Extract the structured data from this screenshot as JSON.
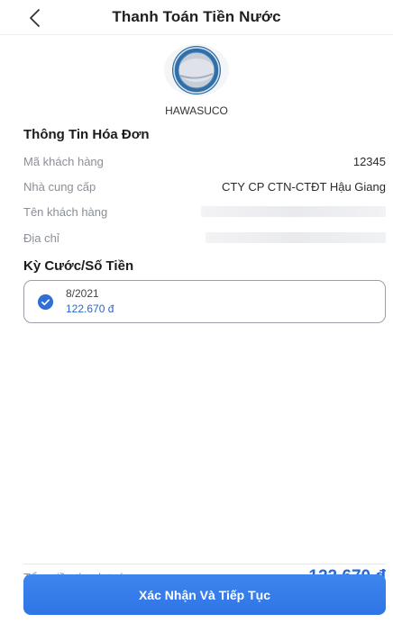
{
  "header": {
    "title": "Thanh Toán Tiền Nước",
    "back_icon": "chevron-left-icon"
  },
  "provider": {
    "logo_icon": "hawasuco-logo",
    "name": "HAWASUCO"
  },
  "invoice": {
    "section_title": "Thông Tin Hóa Đơn",
    "rows": [
      {
        "label": "Mã khách hàng",
        "value": "12345"
      },
      {
        "label": "Nhà cung cấp",
        "value": "CTY CP CTN-CTĐT Hậu Giang"
      },
      {
        "label": "Tên khách hàng",
        "value": ""
      },
      {
        "label": "Địa chỉ",
        "value": ""
      }
    ]
  },
  "period": {
    "section_title": "Kỳ Cước/Số Tiền",
    "items": [
      {
        "month": "8/2021",
        "amount": "122.670 đ",
        "selected": true
      }
    ]
  },
  "footer": {
    "total_label": "Tổng tiền thanh toán",
    "total_value": "122.670 đ",
    "confirm_label": "Xác Nhận Và Tiếp Tục"
  },
  "colors": {
    "accent": "#2f6fd6",
    "button": "#3a80ec",
    "label_gray": "#8a8f98"
  }
}
